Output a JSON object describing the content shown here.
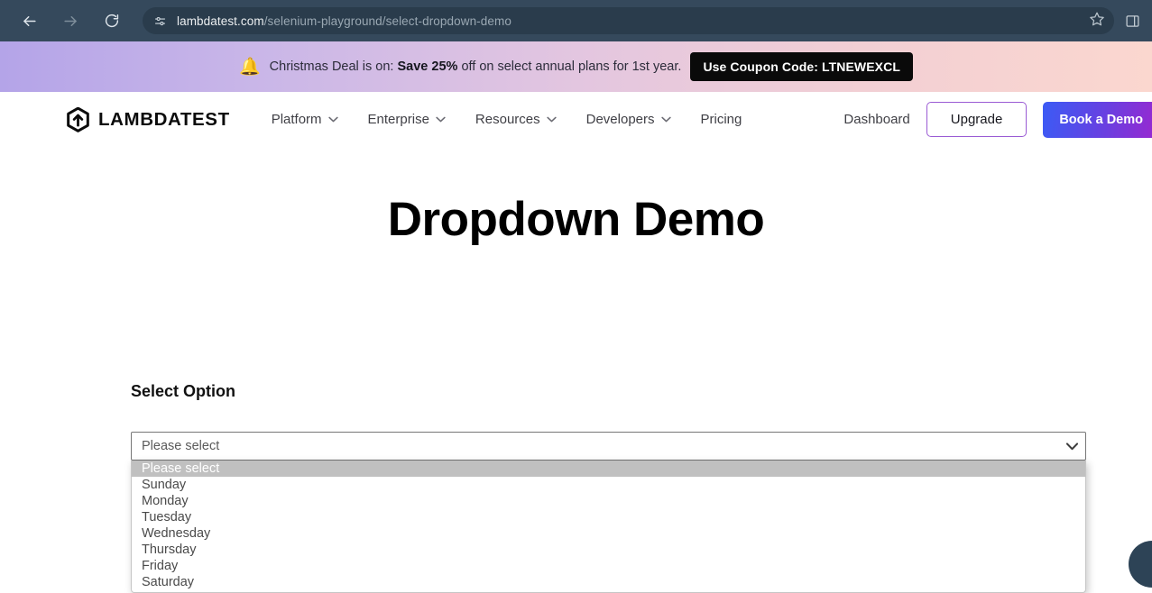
{
  "browser": {
    "back_label": "Back",
    "forward_label": "Forward",
    "reload_label": "Reload",
    "site_info_label": "View site information",
    "url_host": "lambdatest.com",
    "url_path": "/selenium-playground/select-dropdown-demo",
    "bookmark_label": "Bookmark this tab",
    "side_panel_label": "Side panel"
  },
  "promo": {
    "emoji": "🔔",
    "text_before": "Christmas Deal is on: ",
    "text_bold": "Save 25%",
    "text_after": " off on select annual plans for 1st year.",
    "coupon_label": "Use Coupon Code: LTNEWEXCL"
  },
  "header": {
    "logo_text": "LAMBDATEST",
    "nav": [
      {
        "label": "Platform",
        "has_chevron": true
      },
      {
        "label": "Enterprise",
        "has_chevron": true
      },
      {
        "label": "Resources",
        "has_chevron": true
      },
      {
        "label": "Developers",
        "has_chevron": true
      },
      {
        "label": "Pricing",
        "has_chevron": false
      }
    ],
    "dashboard_label": "Dashboard",
    "upgrade_label": "Upgrade",
    "demo_label": "Book a Demo"
  },
  "main": {
    "page_title": "Dropdown Demo",
    "section_label": "Select Option",
    "select": {
      "value": "Please select",
      "expanded": true,
      "options": [
        "Please select",
        "Sunday",
        "Monday",
        "Tuesday",
        "Wednesday",
        "Thursday",
        "Friday",
        "Saturday"
      ],
      "selected_index": 0
    }
  },
  "colors": {
    "browser_chrome": "#35495c",
    "omnibox": "#2a3c4c",
    "banner_start": "#b4a4e8",
    "banner_end": "#fbd7cf",
    "coupon_bg": "#0a0a0a",
    "upgrade_border": "#9a5bd4",
    "demo_gradient_start": "#3b5bf5",
    "demo_gradient_end": "#9b27cf",
    "option_highlight": "#c0c0c0"
  }
}
